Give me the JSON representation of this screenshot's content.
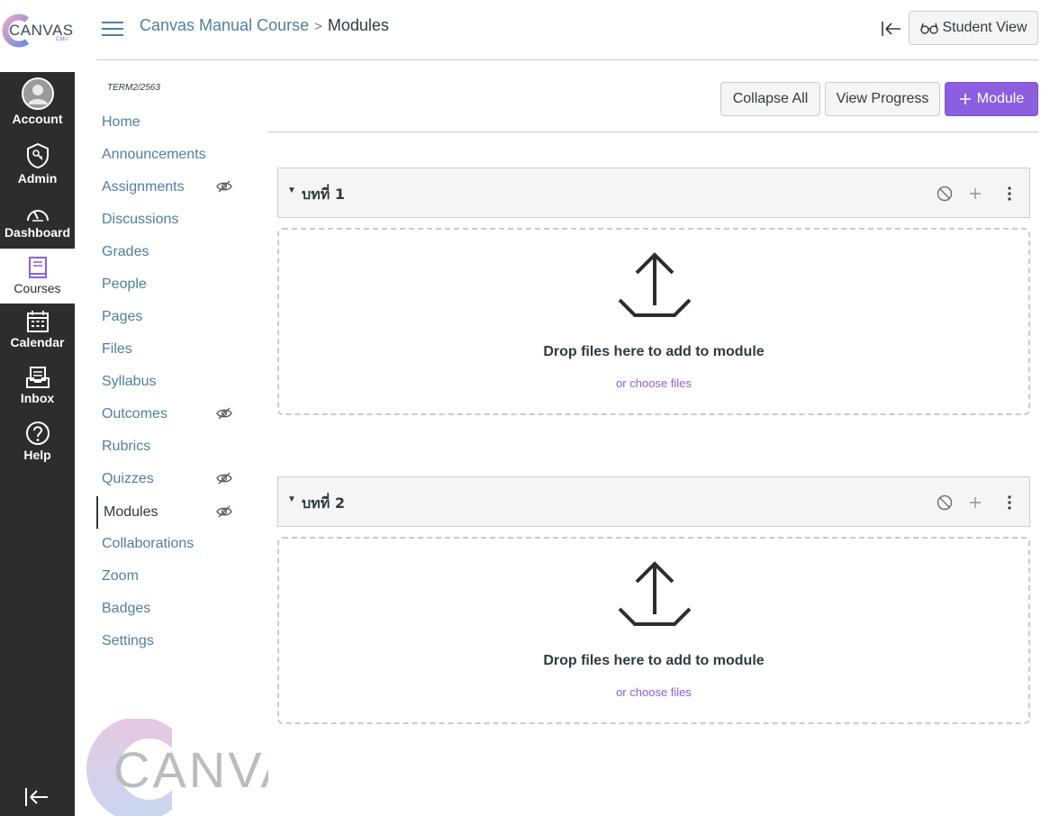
{
  "brand": {
    "logo_word": "CANVAS",
    "logo_sub": "CMU",
    "accent": "#8c5fe0",
    "link": "#4f7fa0"
  },
  "global_nav": {
    "items": [
      {
        "label": "Account",
        "icon": "avatar-icon"
      },
      {
        "label": "Admin",
        "icon": "shield-icon"
      },
      {
        "label": "Dashboard",
        "icon": "dashboard-icon"
      },
      {
        "label": "Courses",
        "icon": "book-icon",
        "active": true
      },
      {
        "label": "Calendar",
        "icon": "calendar-icon"
      },
      {
        "label": "Inbox",
        "icon": "inbox-icon"
      },
      {
        "label": "Help",
        "icon": "help-icon"
      }
    ],
    "collapse_icon": "collapse-left-icon"
  },
  "header": {
    "breadcrumb": {
      "course": "Canvas Manual Course",
      "separator": ">",
      "current": "Modules"
    },
    "student_view": "Student View"
  },
  "course_nav": {
    "term": "TERM2/2563",
    "items": [
      {
        "label": "Home",
        "hidden": false
      },
      {
        "label": "Announcements",
        "hidden": false
      },
      {
        "label": "Assignments",
        "hidden": true
      },
      {
        "label": "Discussions",
        "hidden": false
      },
      {
        "label": "Grades",
        "hidden": false
      },
      {
        "label": "People",
        "hidden": false
      },
      {
        "label": "Pages",
        "hidden": false
      },
      {
        "label": "Files",
        "hidden": false
      },
      {
        "label": "Syllabus",
        "hidden": false
      },
      {
        "label": "Outcomes",
        "hidden": true
      },
      {
        "label": "Rubrics",
        "hidden": false
      },
      {
        "label": "Quizzes",
        "hidden": true
      },
      {
        "label": "Modules",
        "hidden": true,
        "active": true
      },
      {
        "label": "Collaborations",
        "hidden": false
      },
      {
        "label": "Zoom",
        "hidden": false
      },
      {
        "label": "Badges",
        "hidden": false
      },
      {
        "label": "Settings",
        "hidden": false
      }
    ]
  },
  "toolbar": {
    "collapse_all": "Collapse All",
    "view_progress": "View Progress",
    "add_module": "Module"
  },
  "modules": [
    {
      "title": "บทที่ 1",
      "drop_text": "Drop files here to add to module",
      "choose_files": "or choose files"
    },
    {
      "title": "บทที่ 2",
      "drop_text": "Drop files here to add to module",
      "choose_files": "or choose files"
    }
  ],
  "watermark": {
    "text": "CANVAS"
  }
}
